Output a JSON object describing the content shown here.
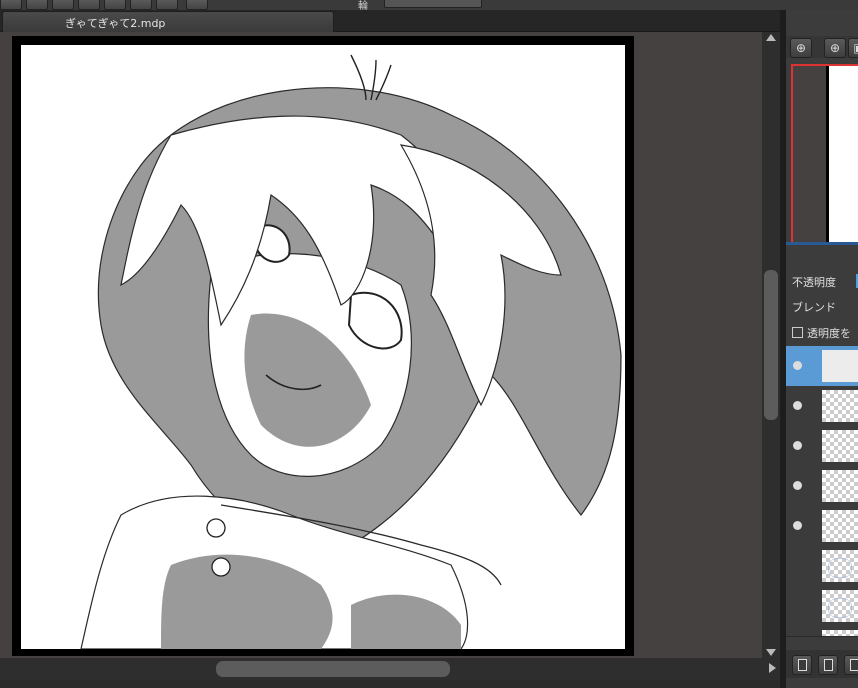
{
  "toolbar": {
    "field_text": "輪"
  },
  "document": {
    "tab_title": "ぎゃてぎゃて2.mdp"
  },
  "navigator": {
    "zoom_in_icon": "magnifier-plus-icon",
    "zoom_plus_icon": "zoom-plus-icon",
    "fit_icon": "fit-icon"
  },
  "layer_properties": {
    "opacity_label": "不透明度",
    "blend_label": "ブレンド",
    "protect_alpha_label": "透明度を"
  },
  "layers": [
    {
      "visible": true,
      "selected": true,
      "thumb": "lineart"
    },
    {
      "visible": true,
      "selected": false,
      "thumb": "transparent"
    },
    {
      "visible": true,
      "selected": false,
      "thumb": "transparent"
    },
    {
      "visible": true,
      "selected": false,
      "thumb": "transparent"
    },
    {
      "visible": true,
      "selected": false,
      "thumb": "transparent"
    },
    {
      "visible": false,
      "selected": false,
      "thumb": "sketch"
    },
    {
      "visible": false,
      "selected": false,
      "thumb": "sketch"
    },
    {
      "visible": false,
      "selected": false,
      "thumb": "sketch"
    }
  ],
  "layer_footer": {
    "buttons": [
      "new-layer-icon",
      "new-folder-icon",
      "layer-options-icon"
    ]
  },
  "colors": {
    "canvas_bg": "#444140",
    "selection_blue": "#5b9bd5",
    "navigator_frame": "#dd3333"
  }
}
